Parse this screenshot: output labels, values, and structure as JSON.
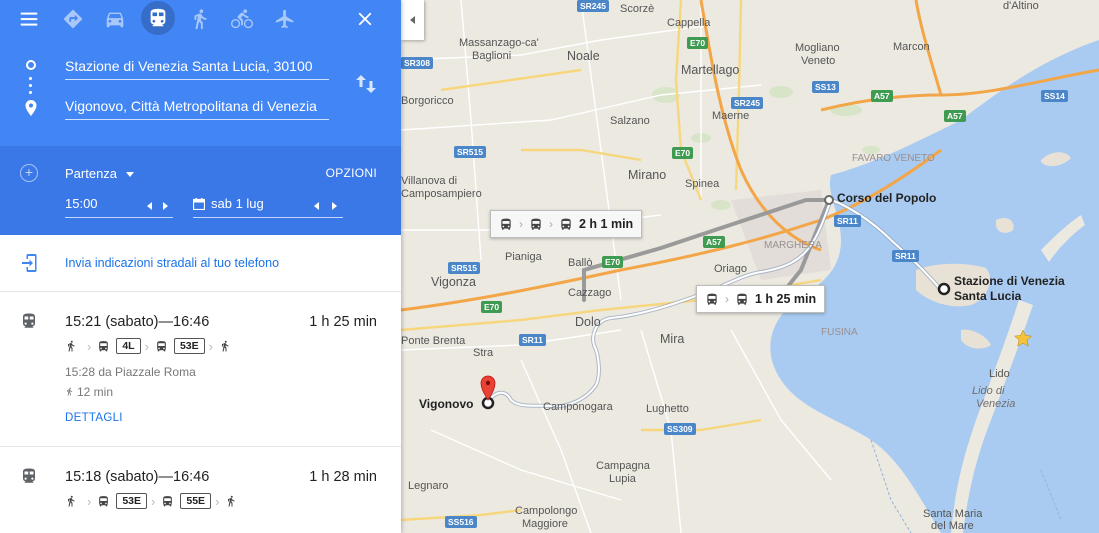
{
  "modes": [
    {
      "name": "best-route",
      "icon": "directions-diamond-icon"
    },
    {
      "name": "car",
      "icon": "car-icon"
    },
    {
      "name": "transit",
      "icon": "train-icon",
      "active": true
    },
    {
      "name": "walking",
      "icon": "walk-icon"
    },
    {
      "name": "cycling",
      "icon": "bicycle-icon"
    },
    {
      "name": "flight",
      "icon": "plane-icon"
    }
  ],
  "origin": {
    "value": "Stazione di Venezia Santa Lucia, 30100"
  },
  "destination": {
    "value": "Vigonovo, Città Metropolitana di Venezia"
  },
  "depart": {
    "label": "Partenza",
    "options_label": "OPZIONI",
    "time": "15:00",
    "date": "sab 1 lug"
  },
  "send_to_phone": "Invia indicazioni stradali al tuo telefono",
  "routes": [
    {
      "times": "15:21 (sabato)—16:46",
      "duration": "1 h 25 min",
      "steps": [
        "walk",
        "bus:4L",
        "bus:53E",
        "walk"
      ],
      "lines": [
        "4L",
        "53E"
      ],
      "from_text": "15:28 da Piazzale Roma",
      "walk_text": "12 min",
      "details_label": "DETTAGLI"
    },
    {
      "times": "15:18 (sabato)—16:46",
      "duration": "1 h 28 min",
      "steps": [
        "walk",
        "bus:53E",
        "bus:55E",
        "walk"
      ],
      "lines": [
        "53E",
        "55E"
      ]
    }
  ],
  "map": {
    "callouts": [
      {
        "label": "2 h 1 min",
        "kind": "alternative"
      },
      {
        "label": "1 h 25 min",
        "kind": "selected"
      }
    ],
    "origin_label": "Stazione di Venezia\nSanta Lucia",
    "destination_label": "Vigonovo",
    "waypoint_label": "Corso del Popolo",
    "places": [
      "Scorzè",
      "Cappella",
      "d'Altino",
      "Massanzago-ca'",
      "Baglioni",
      "Noale",
      "Martellago",
      "Mogliano",
      "Veneto",
      "Marcon",
      "Borgoricco",
      "Maerne",
      "Salzano",
      "FAVARO VENETO",
      "Villanova di",
      "Camposampiero",
      "Mirano",
      "Spinea",
      "MARGHERA",
      "Pianiga",
      "Ballò",
      "Oriago",
      "Vigonza",
      "Cazzago",
      "Dolo",
      "Mira",
      "FUSINA",
      "Lido",
      "Lido di",
      "Venezia",
      "Stra",
      "Camponogara",
      "Lughetto",
      "Campagna",
      "Lupia",
      "Legnaro",
      "Campolongo",
      "Maggiore",
      "Santa Maria",
      "del Mare",
      "Ponte Brenta"
    ],
    "roads": [
      "SR245",
      "E70",
      "SR515",
      "SR245",
      "SS13",
      "A57",
      "SS14",
      "A57",
      "SR308",
      "E70",
      "SR11",
      "A57",
      "E70",
      "SR11",
      "SR515",
      "E70",
      "SR11",
      "SS309",
      "SS516"
    ]
  }
}
